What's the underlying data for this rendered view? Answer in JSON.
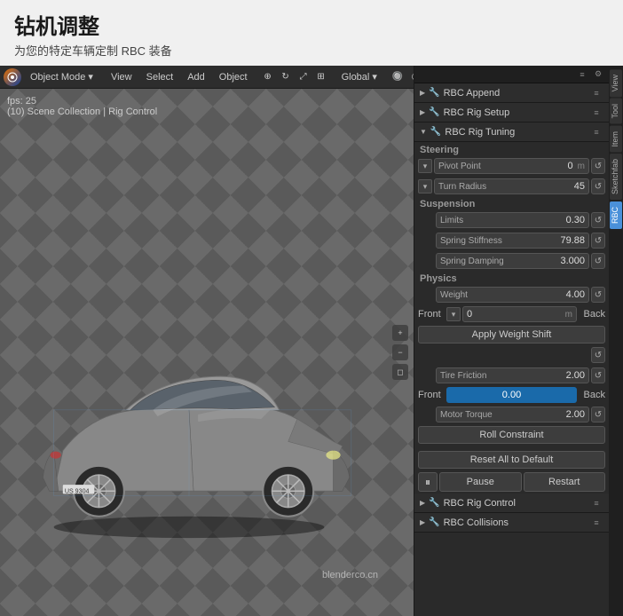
{
  "header": {
    "title": "钻机调整",
    "subtitle": "为您的特定车辆定制 RBC 装备"
  },
  "toolbar": {
    "mode": "Object Mode",
    "menus": [
      "View",
      "Select",
      "Add",
      "Object"
    ],
    "transform": "Global",
    "select_label": "Select"
  },
  "viewport": {
    "fps": "fps: 25",
    "scene_info": "(10) Scene Collection | Rig Control",
    "watermark": "blenderco.cn"
  },
  "side_tabs": [
    {
      "label": "View",
      "active": false
    },
    {
      "label": "Tool",
      "active": false
    },
    {
      "label": "Item",
      "active": false
    },
    {
      "label": "Sketchfab",
      "active": false
    },
    {
      "label": "RBC",
      "active": true
    }
  ],
  "panel": {
    "sections": [
      {
        "label": "RBC Append",
        "collapsed": true,
        "icon": "🔧"
      },
      {
        "label": "RBC Rig Setup",
        "collapsed": true,
        "icon": "🔧"
      },
      {
        "label": "RBC Rig Tuning",
        "collapsed": false,
        "icon": "🔧"
      }
    ],
    "steering": {
      "label": "Steering",
      "pivot_point": {
        "label": "Pivot Point",
        "value": "0",
        "unit": "m"
      },
      "turn_radius": {
        "label": "Turn Radius",
        "value": "45",
        "unit": ""
      }
    },
    "suspension": {
      "label": "Suspension",
      "limits": {
        "label": "Limits",
        "value": "0.30",
        "unit": ""
      },
      "spring_stiffness": {
        "label": "Spring Stiffness",
        "value": "79.88",
        "unit": ""
      },
      "spring_damping": {
        "label": "Spring Damping",
        "value": "3.000",
        "unit": ""
      }
    },
    "physics": {
      "label": "Physics",
      "weight": {
        "label": "Weight",
        "value": "4.00",
        "unit": ""
      },
      "front_label": "Front",
      "back_label": "Back",
      "front_value": "0",
      "front_unit": "m",
      "apply_weight_shift": "Apply Weight Shift",
      "tire_friction": {
        "label": "Tire Friction",
        "value": "2.00",
        "unit": ""
      },
      "tire_front_label": "Front",
      "tire_back_label": "Back",
      "tire_front_value": "0.00",
      "motor_torque": {
        "label": "Motor Torque",
        "value": "2.00",
        "unit": ""
      },
      "roll_constraint": "Roll Constraint",
      "reset_all": "Reset All to Default"
    },
    "playback": {
      "pause_label": "Pause",
      "restart_label": "Restart"
    },
    "bottom_sections": [
      {
        "label": "RBC Rig Control",
        "icon": "🔧"
      },
      {
        "label": "RBC Collisions",
        "icon": "🔧"
      }
    ]
  }
}
